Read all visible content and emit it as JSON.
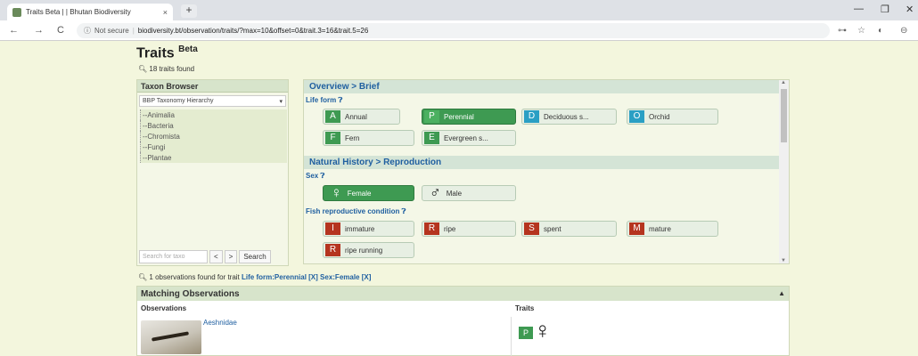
{
  "browser": {
    "tab_title": "Traits Beta | | Bhutan Biodiversity",
    "tab_close": "×",
    "new_tab": "+",
    "not_secure": "Not secure",
    "url": "biodiversity.bt/observation/traits/?max=10&offset=0&trait.3=16&trait.5=26",
    "controls": {
      "minimize": "—",
      "maximize": "❐",
      "close": "✕"
    },
    "nav": {
      "back": "←",
      "forward": "→",
      "reload": "C"
    },
    "icons": {
      "info": "ⓘ",
      "key": "⊶",
      "star": "☆",
      "ext": "◐",
      "profile": "⊖"
    }
  },
  "page": {
    "title": "Traits",
    "title_sup": "Beta",
    "traits_found": "18 traits found"
  },
  "taxon_browser": {
    "heading": "Taxon Browser",
    "hierarchy_select": "BBP Taxonomy Hierarchy",
    "tree": [
      "Animalia",
      "Bacteria",
      "Chromista",
      "Fungi",
      "Plantae"
    ],
    "search_placeholder": "Search for taxo",
    "prev": "<",
    "next": ">",
    "search_button": "Search"
  },
  "overview": {
    "sections": [
      {
        "heading": "Overview > Brief"
      },
      {
        "heading": "Natural History > Reproduction"
      }
    ],
    "life_form": {
      "label": "Life form",
      "chips": [
        {
          "icon": "A",
          "label": "Annual",
          "color": "#3e9a52",
          "selected": false
        },
        {
          "icon": "P",
          "label": "Perennial",
          "color": "#3e9a52",
          "selected": true
        },
        {
          "icon": "D",
          "label": "Deciduous s...",
          "color": "#2a9fc4",
          "selected": false
        },
        {
          "icon": "O",
          "label": "Orchid",
          "color": "#2a9fc4",
          "selected": false
        },
        {
          "icon": "F",
          "label": "Fern",
          "color": "#3e9a52",
          "selected": false
        },
        {
          "icon": "E",
          "label": "Evergreen s...",
          "color": "#3e9a52",
          "selected": false
        }
      ]
    },
    "sex": {
      "label": "Sex",
      "chips": [
        {
          "icon": "♀",
          "label": "Female",
          "selected": true
        },
        {
          "icon": "♂",
          "label": "Male",
          "selected": false
        }
      ]
    },
    "fish_repro": {
      "label": "Fish reproductive condition",
      "chips": [
        {
          "icon": "I",
          "label": "immature",
          "color": "#b5341f"
        },
        {
          "icon": "R",
          "label": "ripe",
          "color": "#b5341f"
        },
        {
          "icon": "S",
          "label": "spent",
          "color": "#b5341f"
        },
        {
          "icon": "M",
          "label": "mature",
          "color": "#b5341f"
        },
        {
          "icon": "R",
          "label": "ripe running",
          "color": "#b5341f"
        }
      ]
    }
  },
  "results": {
    "found_prefix": "1 observations found for trait",
    "found_traits": "Life form:Perennial [X] Sex:Female [X]",
    "matching_heading": "Matching Observations",
    "col_observations": "Observations",
    "col_traits": "Traits",
    "rows": [
      {
        "name": "Aeshnidae",
        "trait_icon": "P",
        "trait_sex": "♀"
      }
    ]
  }
}
